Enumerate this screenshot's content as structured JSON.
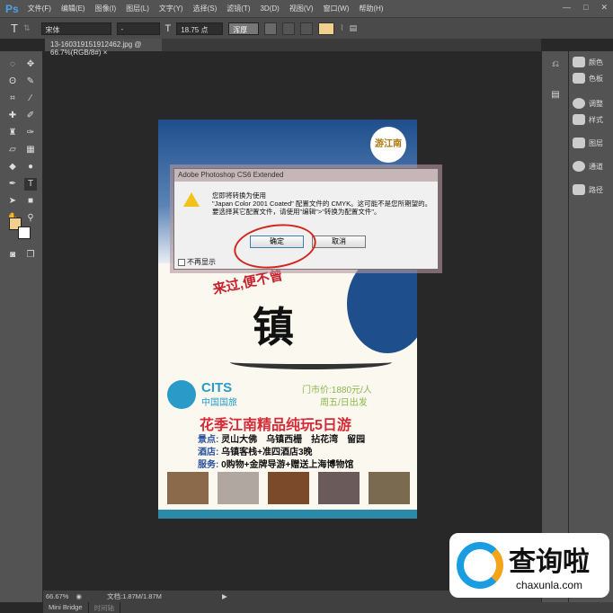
{
  "app": {
    "logo": "Ps",
    "menus": [
      "文件(F)",
      "编辑(E)",
      "图像(I)",
      "图层(L)",
      "文字(Y)",
      "选择(S)",
      "滤镜(T)",
      "3D(D)",
      "视图(V)",
      "窗口(W)",
      "帮助(H)"
    ],
    "win": [
      "—",
      "□",
      "✕"
    ]
  },
  "options": {
    "font_family": "宋体",
    "font_style": "-",
    "font_size": "18.75 点",
    "antialias": "浑厚",
    "color": "#f0d08a"
  },
  "document": {
    "tab_title": "13-160319151912462.jpg @ 66.7%(RGB/8#)",
    "tab_close": "×"
  },
  "panels": [
    {
      "label": "颜色"
    },
    {
      "label": "色板"
    },
    {
      "label": "调整"
    },
    {
      "label": "样式"
    },
    {
      "label": "图层"
    },
    {
      "label": "通道"
    },
    {
      "label": "路径"
    }
  ],
  "poster": {
    "badge": "游江南",
    "slogan": "来过,便不曾",
    "big": "镇",
    "brand_en": "CITS",
    "brand_cn": "中国国旅",
    "price": "门市价:1880元/人",
    "schedule": "周五/日出发",
    "headline": "花季江南精品纯玩5日游",
    "lines": [
      {
        "k": "景点:",
        "v": "灵山大佛　乌镇西栅　拈花湾　留园"
      },
      {
        "k": "酒店:",
        "v": "乌镇客栈+准四酒店3晚"
      },
      {
        "k": "服务:",
        "v": "0购物+金牌导游+赠送上海博物馆"
      }
    ]
  },
  "dialog": {
    "title": "Adobe Photoshop CS6 Extended",
    "line1": "您即将转换为使用",
    "line2": "\"Japan Color 2001 Coated\" 配置文件的 CMYK。这可能不是您所期望的。",
    "line3": "要选择其它配置文件，请使用\"编辑\">\"转换为配置文件\"。",
    "ok": "确定",
    "cancel": "取消",
    "checkbox": "不再显示"
  },
  "status": {
    "zoom": "66.67%",
    "doc": "文档:1.87M/1.87M"
  },
  "bottom_tabs": [
    "Mini Bridge",
    "时间轴"
  ],
  "watermark": {
    "cn": "查询啦",
    "en": "chaxunla.com"
  }
}
